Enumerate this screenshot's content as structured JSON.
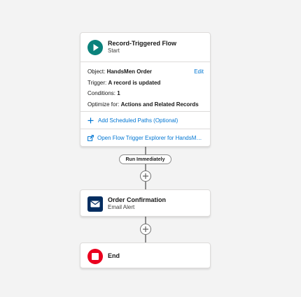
{
  "start": {
    "title": "Record-Triggered Flow",
    "subtitle": "Start",
    "icon": "play-icon",
    "icon_color": "#0b827c",
    "edit_label": "Edit",
    "object_label": "Object:",
    "object_value": "HandsMen Order",
    "trigger_label": "Trigger:",
    "trigger_value": "A record is updated",
    "conditions_label": "Conditions:",
    "conditions_value": "1",
    "optimize_label": "Optimize for:",
    "optimize_value": "Actions and Related Records",
    "add_scheduled_paths": "Add Scheduled Paths (Optional)",
    "open_explorer": "Open Flow Trigger Explorer for HandsMen Order"
  },
  "path_label": "Run Immediately",
  "email_alert": {
    "title": "Order Confirmation",
    "subtitle": "Email Alert",
    "icon": "envelope-icon",
    "icon_color": "#032d60"
  },
  "end": {
    "title": "End",
    "icon": "stop-icon",
    "icon_color": "#ea001e"
  },
  "colors": {
    "link": "#0176d3",
    "connector": "#8c8c8c",
    "background": "#f3f3f3"
  }
}
